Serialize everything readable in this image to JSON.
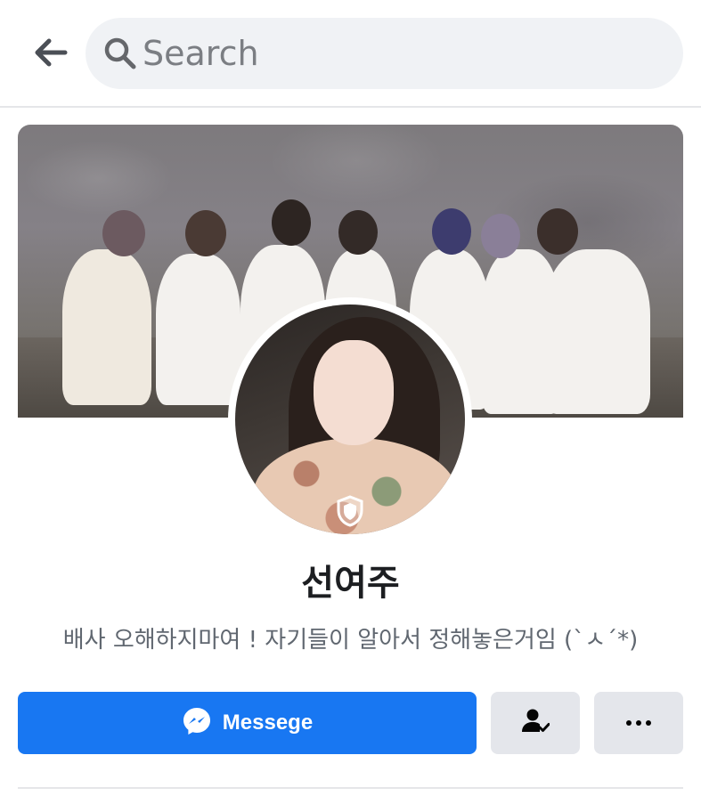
{
  "search": {
    "placeholder": "Search"
  },
  "icons": {
    "back": "arrow-left-icon",
    "search": "search-icon",
    "messenger": "messenger-icon",
    "friend": "friend-check-icon",
    "more": "more-dots-icon",
    "shield": "profile-guard-shield-icon"
  },
  "profile": {
    "name": "선여주",
    "bio": "배사 오해하지마여 ! 자기들이 알아서 정해놓은거임 (`ㅅ´*)"
  },
  "actions": {
    "message_label": "Messege"
  },
  "colors": {
    "accent": "#1877f2",
    "button_gray": "#e4e6eb",
    "search_bg": "#f0f2f5",
    "text_primary": "#1c1e21",
    "text_secondary": "#606770"
  }
}
